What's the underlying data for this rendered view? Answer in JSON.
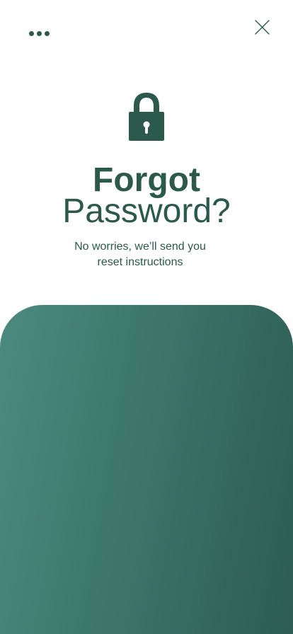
{
  "header": {
    "more_icon": "more-horizontal-icon",
    "close_icon": "close-icon"
  },
  "hero": {
    "icon": "lock-icon",
    "title_line1": "Forgot",
    "title_line2": "Password?",
    "subtitle_line1": "No worries, we’ll send you",
    "subtitle_line2": "reset instructions"
  },
  "colors": {
    "primary": "#2b5a4c",
    "panel_start": "#4b8a7f",
    "panel_end": "#2d5c51",
    "background": "#ffffff"
  }
}
